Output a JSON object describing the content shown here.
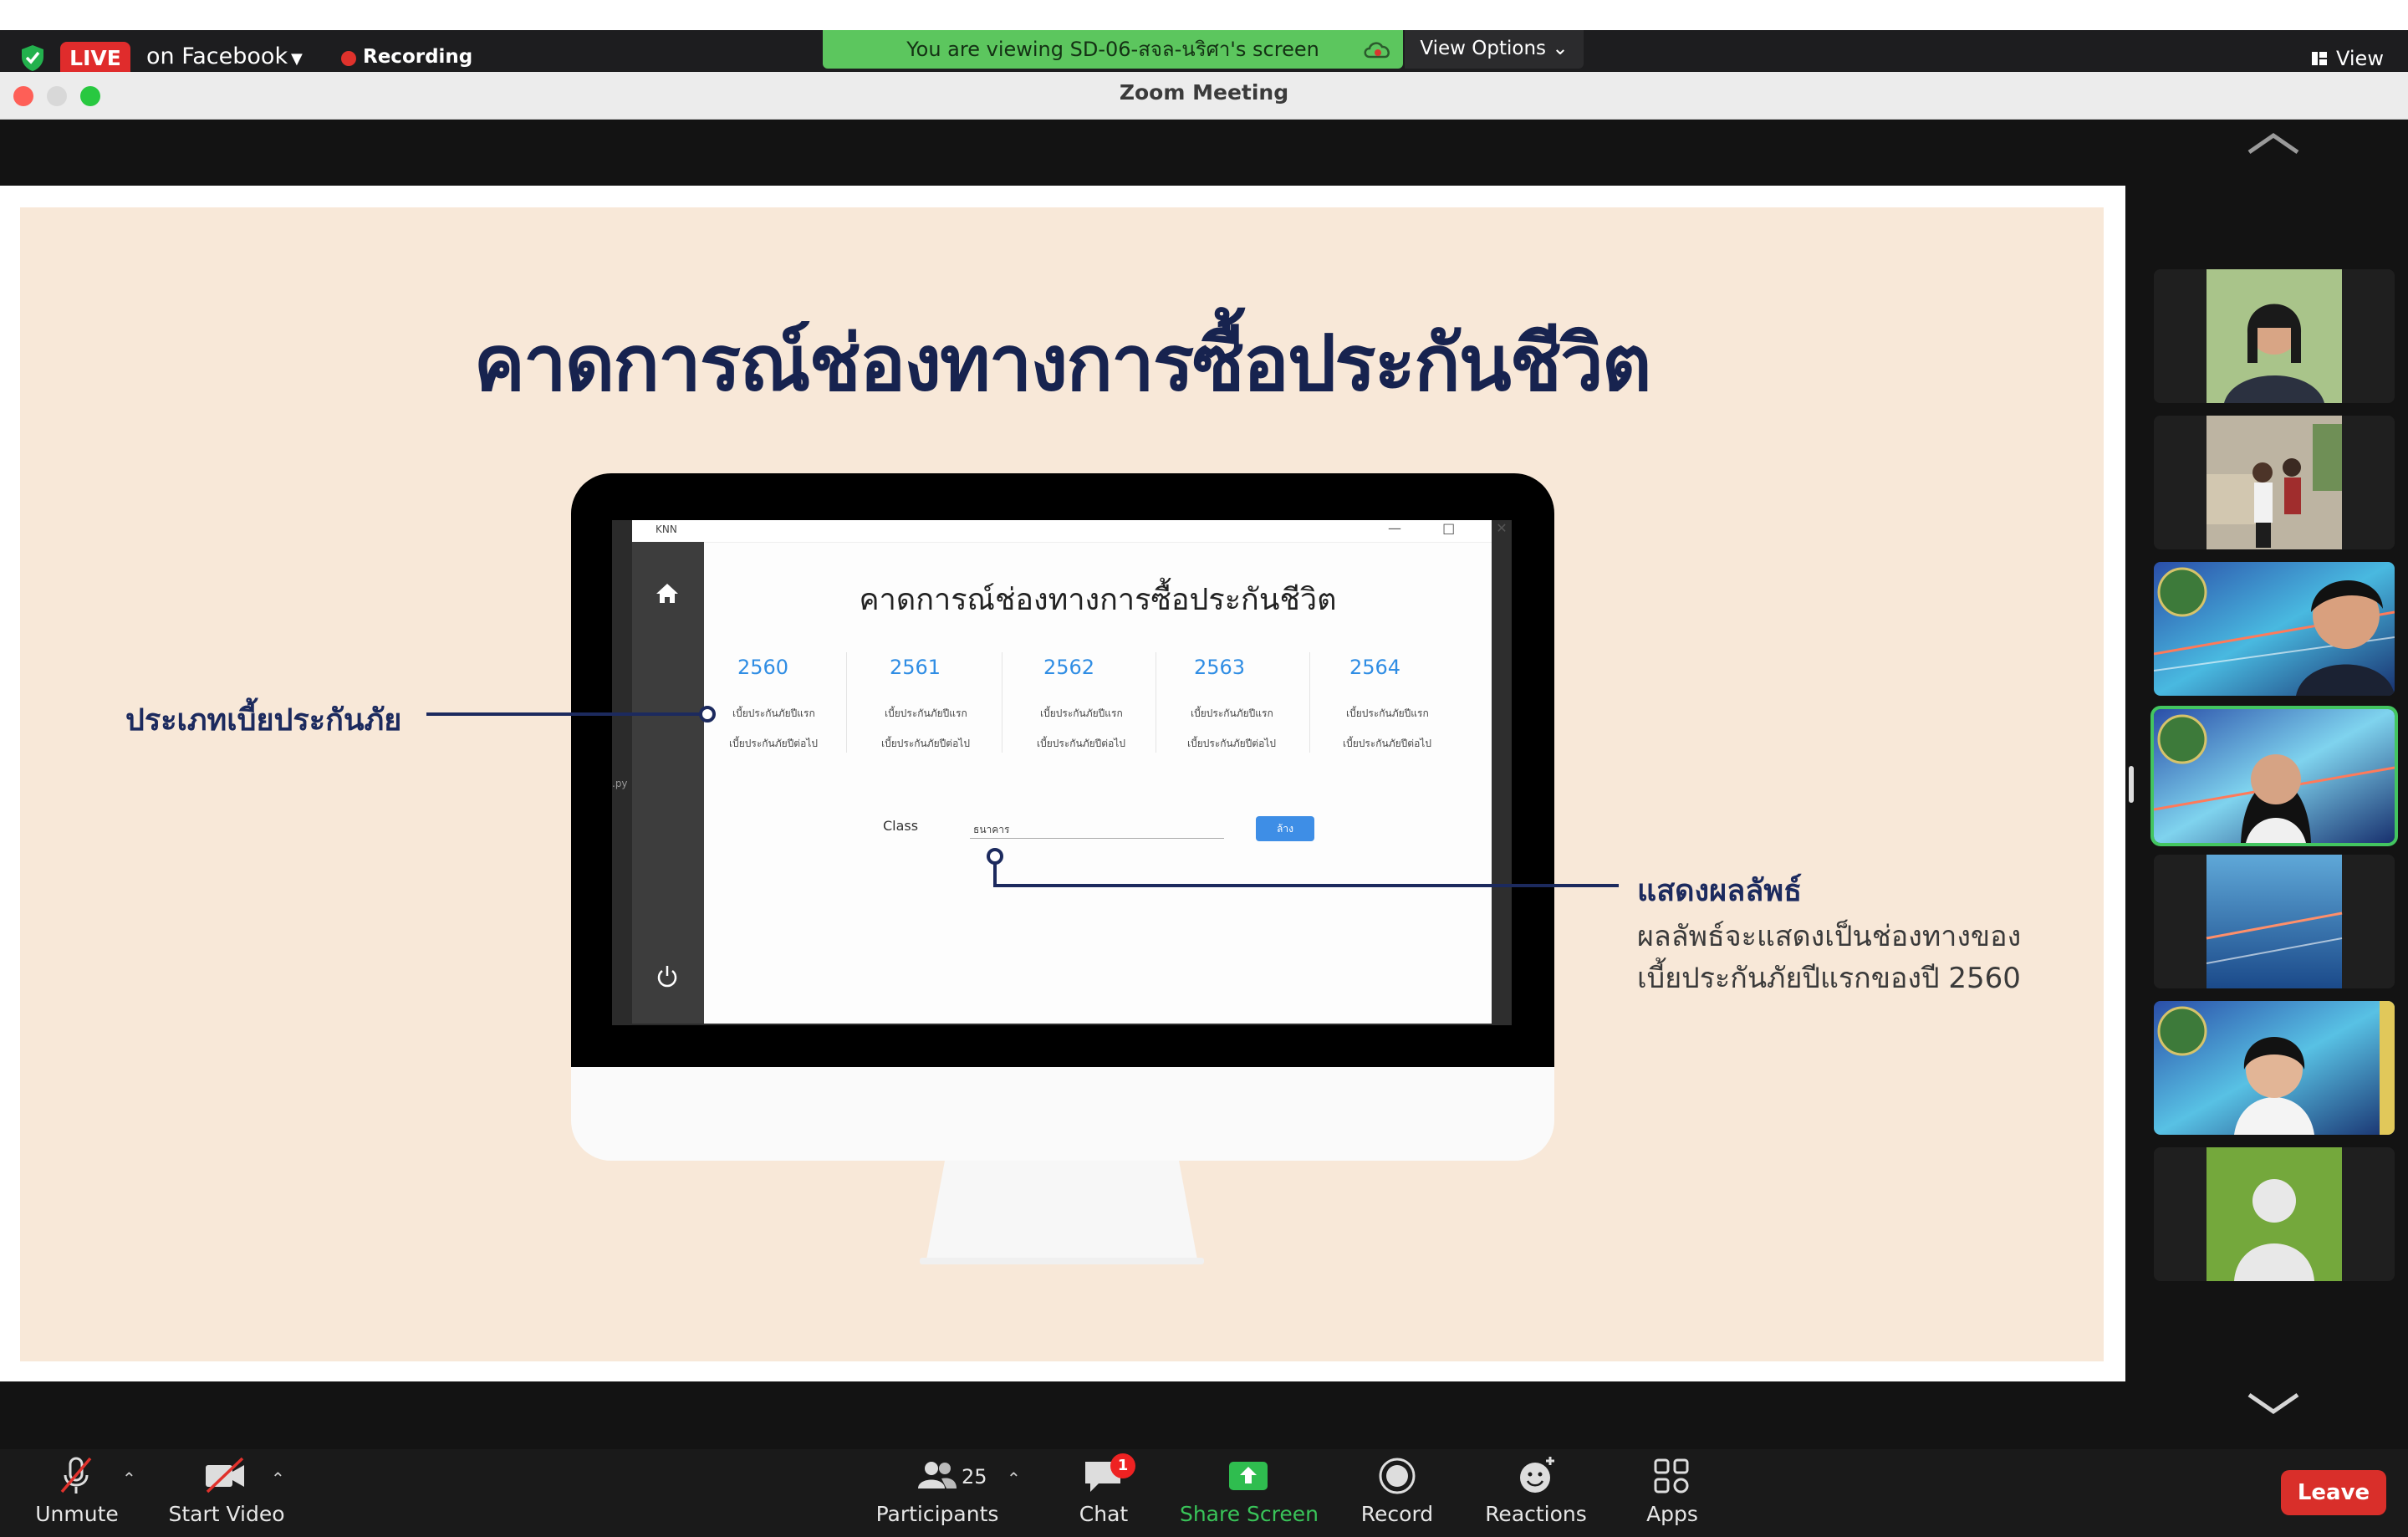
{
  "top_bar": {
    "live_badge": "LIVE",
    "live_target": "on Facebook",
    "recording_label": "Recording",
    "share_banner": "You are viewing SD-06-สจล-นริศา's screen",
    "view_options": "View Options ⌄",
    "view_button": "View"
  },
  "window": {
    "title": "Zoom Meeting"
  },
  "slide": {
    "title": "คาดการณ์ช่องทางการซื้อประกันชีวิต",
    "annotation_left": "ประเภทเบี้ยประกันภัย",
    "annotation_right_title": "แสดงผลลัพธ์",
    "annotation_right_line1": "ผลลัพธ์จะแสดงเป็นช่องทางของ",
    "annotation_right_line2": "เบี้ยประกันภัยปีแรกของปี 2560"
  },
  "app": {
    "window_title": "KNN",
    "window_controls": "— □ ✕",
    "side_text": ".py",
    "heading": "คาดการณ์ช่องทางการซื้อประกันชีวิต",
    "years": [
      "2560",
      "2561",
      "2562",
      "2563",
      "2564"
    ],
    "option_first": "เบี้ยประกันภัยปีแรก",
    "option_next": "เบี้ยประกันภัยปีต่อไป",
    "class_label": "Class",
    "class_value": "ธนาคาร",
    "submit_label": "ล้าง"
  },
  "participants": [
    "participant-1",
    "participant-2",
    "participant-3",
    "participant-4",
    "participant-5",
    "participant-6",
    "participant-7"
  ],
  "toolbar": {
    "unmute": "Unmute",
    "start_video": "Start Video",
    "participants": "Participants",
    "participants_count": "25",
    "chat": "Chat",
    "chat_badge": "1",
    "share_screen": "Share Screen",
    "record": "Record",
    "reactions": "Reactions",
    "apps": "Apps",
    "leave": "Leave"
  },
  "colors": {
    "share_green": "#5cc65e",
    "live_red": "#e02c2c",
    "leave_red": "#d92f2a",
    "slide_bg": "#f8e8d8",
    "slide_navy": "#17234f",
    "app_blue": "#2f8de4"
  }
}
